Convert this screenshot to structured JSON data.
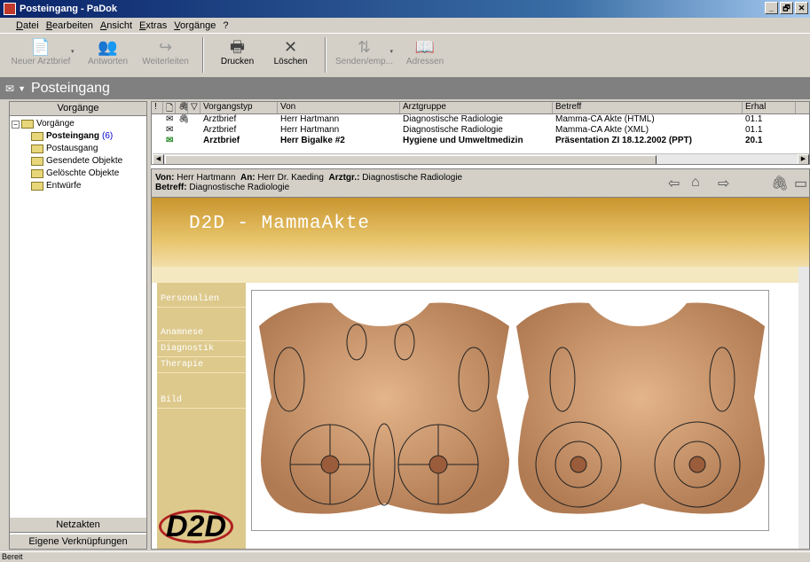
{
  "window": {
    "title": "Posteingang - PaDok",
    "buttons": [
      "_",
      "🗗",
      "✕"
    ]
  },
  "menu": [
    "Datei",
    "Bearbeiten",
    "Ansicht",
    "Extras",
    "Vorgänge",
    "?"
  ],
  "toolbar": {
    "new": "Neuer Arztbrief",
    "reply": "Antworten",
    "forward": "Weiterleiten",
    "print": "Drucken",
    "delete": "Löschen",
    "send": "Senden/emp...",
    "addresses": "Adressen"
  },
  "folder": {
    "title": "Posteingang"
  },
  "sidebar": {
    "header": "Vorgänge",
    "root": "Vorgänge",
    "items": [
      {
        "label": "Posteingang",
        "count": "(6)"
      },
      {
        "label": "Postausgang"
      },
      {
        "label": "Gesendete Objekte"
      },
      {
        "label": "Gelöschte Objekte"
      },
      {
        "label": "Entwürfe"
      }
    ],
    "btn_netz": "Netzakten",
    "btn_eigene": "Eigene Verknüpfungen"
  },
  "messages": {
    "columns": [
      "!",
      "🗋",
      "🖇",
      "▽",
      "Vorgangstyp",
      "Von",
      "Arztgruppe",
      "Betreff",
      "Erhal"
    ],
    "rows": [
      {
        "type": "Arztbrief",
        "from": "Herr Hartmann",
        "group": "Diagnostische Radiologie",
        "subject": "Mamma-CA Akte (HTML)",
        "received": "01.1"
      },
      {
        "type": "Arztbrief",
        "from": "Herr Hartmann",
        "group": "Diagnostische Radiologie",
        "subject": "Mamma-CA Akte (XML)",
        "received": "01.1"
      },
      {
        "type": "Arztbrief",
        "from": "Herr Bigalke #2",
        "group": "Hygiene und Umweltmedizin",
        "subject": "Präsentation ZI 18.12.2002 (PPT)",
        "received": "20.1"
      }
    ]
  },
  "preview": {
    "von_label": "Von:",
    "von": "Herr Hartmann",
    "an_label": "An:",
    "an": "Herr Dr. Kaeding",
    "arztgr_label": "Arztgr.:",
    "arztgr": "Diagnostische Radiologie",
    "betreff_label": "Betreff:",
    "betreff": "Diagnostische Radiologie"
  },
  "doc": {
    "title": "D2D  - MammaAkte",
    "nav": [
      "Personalien",
      "Anamnese",
      "Diagnostik",
      "Therapie",
      "Bild"
    ],
    "logo": "D2D"
  },
  "status": "Bereit"
}
